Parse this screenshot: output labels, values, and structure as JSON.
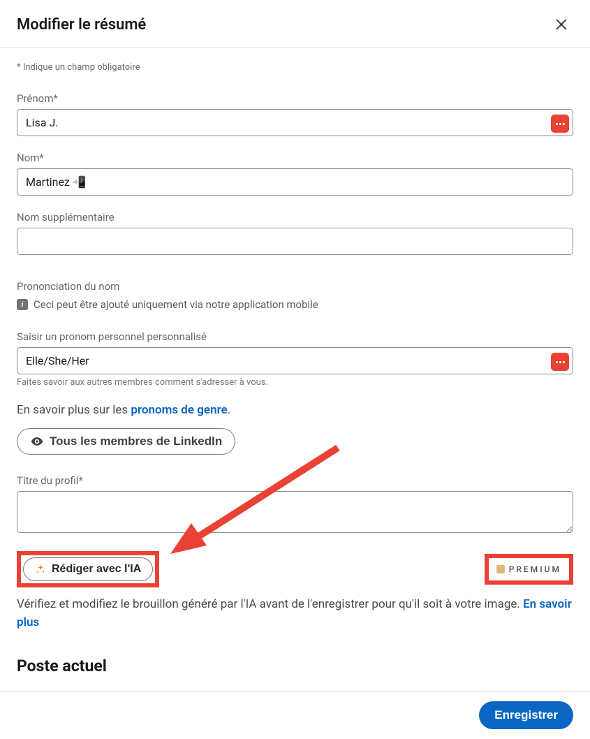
{
  "header": {
    "title": "Modifier le résumé"
  },
  "required_note": "* Indique un champ obligatoire",
  "fields": {
    "first_name": {
      "label": "Prénom*",
      "value": "Lisa J."
    },
    "last_name": {
      "label": "Nom*",
      "value": "Martinez 📲"
    },
    "additional_name": {
      "label": "Nom supplémentaire",
      "value": ""
    },
    "pronoun": {
      "label": "Saisir un pronom personnel personnalisé",
      "value": "Elle/She/Her",
      "helper": "Faites savoir aux autres membres comment s'adresser à vous."
    },
    "headline": {
      "label": "Titre du profil*",
      "value": ""
    }
  },
  "pronunciation": {
    "label": "Prononciation du nom",
    "info": "Ceci peut être ajouté uniquement via notre application mobile"
  },
  "pronoun_learn": {
    "prefix": "En savoir plus sur les ",
    "link": "pronoms de genre",
    "suffix": "."
  },
  "visibility": {
    "label": "Tous les membres de LinkedIn"
  },
  "ai": {
    "button": "Rédiger avec l'IA",
    "premium": "PREMIUM",
    "description_prefix": "Vérifiez et modifiez le brouillon généré par l'IA avant de l'enregistrer pour qu'il soit à votre image. ",
    "description_link": "En savoir plus"
  },
  "section_heading": "Poste actuel",
  "footer": {
    "save": "Enregistrer"
  },
  "colors": {
    "highlight": "#e94235",
    "link": "#0a66c2",
    "primary": "#0a66c2"
  }
}
